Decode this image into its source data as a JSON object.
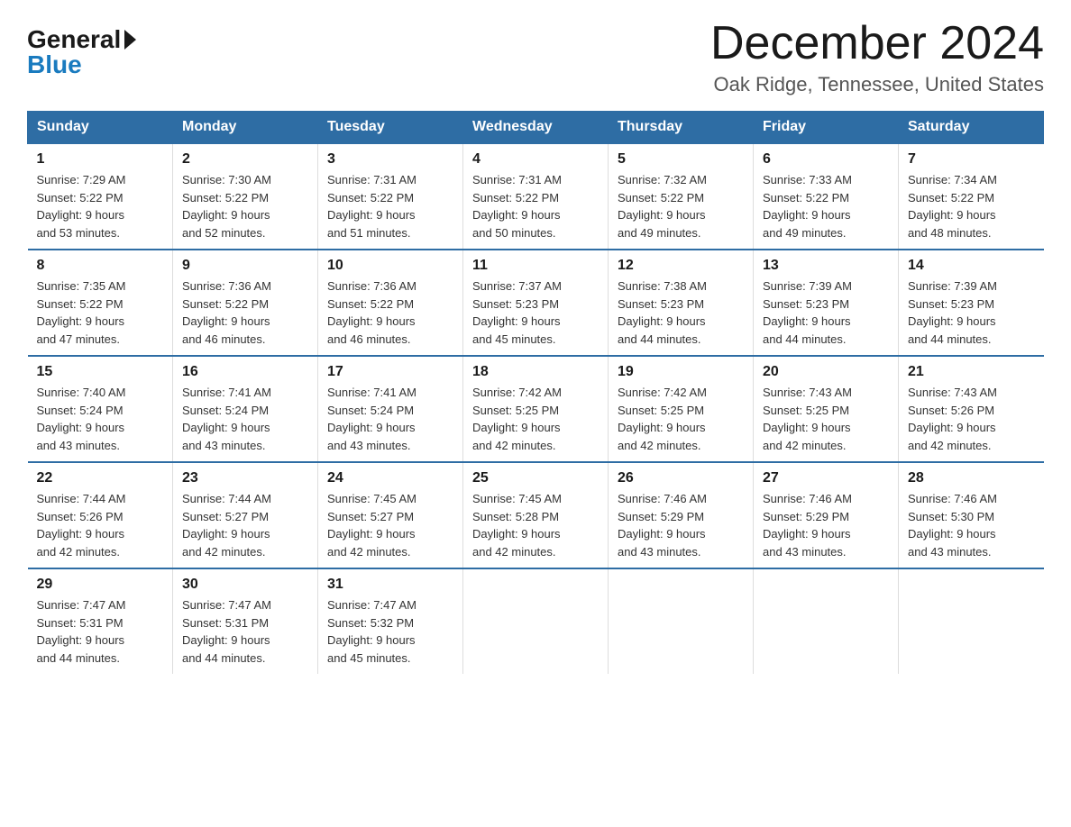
{
  "logo": {
    "general": "General",
    "blue": "Blue"
  },
  "title": {
    "month": "December 2024",
    "location": "Oak Ridge, Tennessee, United States"
  },
  "header": {
    "days": [
      "Sunday",
      "Monday",
      "Tuesday",
      "Wednesday",
      "Thursday",
      "Friday",
      "Saturday"
    ]
  },
  "weeks": [
    [
      {
        "day": "1",
        "sunrise": "7:29 AM",
        "sunset": "5:22 PM",
        "daylight": "9 hours and 53 minutes."
      },
      {
        "day": "2",
        "sunrise": "7:30 AM",
        "sunset": "5:22 PM",
        "daylight": "9 hours and 52 minutes."
      },
      {
        "day": "3",
        "sunrise": "7:31 AM",
        "sunset": "5:22 PM",
        "daylight": "9 hours and 51 minutes."
      },
      {
        "day": "4",
        "sunrise": "7:31 AM",
        "sunset": "5:22 PM",
        "daylight": "9 hours and 50 minutes."
      },
      {
        "day": "5",
        "sunrise": "7:32 AM",
        "sunset": "5:22 PM",
        "daylight": "9 hours and 49 minutes."
      },
      {
        "day": "6",
        "sunrise": "7:33 AM",
        "sunset": "5:22 PM",
        "daylight": "9 hours and 49 minutes."
      },
      {
        "day": "7",
        "sunrise": "7:34 AM",
        "sunset": "5:22 PM",
        "daylight": "9 hours and 48 minutes."
      }
    ],
    [
      {
        "day": "8",
        "sunrise": "7:35 AM",
        "sunset": "5:22 PM",
        "daylight": "9 hours and 47 minutes."
      },
      {
        "day": "9",
        "sunrise": "7:36 AM",
        "sunset": "5:22 PM",
        "daylight": "9 hours and 46 minutes."
      },
      {
        "day": "10",
        "sunrise": "7:36 AM",
        "sunset": "5:22 PM",
        "daylight": "9 hours and 46 minutes."
      },
      {
        "day": "11",
        "sunrise": "7:37 AM",
        "sunset": "5:23 PM",
        "daylight": "9 hours and 45 minutes."
      },
      {
        "day": "12",
        "sunrise": "7:38 AM",
        "sunset": "5:23 PM",
        "daylight": "9 hours and 44 minutes."
      },
      {
        "day": "13",
        "sunrise": "7:39 AM",
        "sunset": "5:23 PM",
        "daylight": "9 hours and 44 minutes."
      },
      {
        "day": "14",
        "sunrise": "7:39 AM",
        "sunset": "5:23 PM",
        "daylight": "9 hours and 44 minutes."
      }
    ],
    [
      {
        "day": "15",
        "sunrise": "7:40 AM",
        "sunset": "5:24 PM",
        "daylight": "9 hours and 43 minutes."
      },
      {
        "day": "16",
        "sunrise": "7:41 AM",
        "sunset": "5:24 PM",
        "daylight": "9 hours and 43 minutes."
      },
      {
        "day": "17",
        "sunrise": "7:41 AM",
        "sunset": "5:24 PM",
        "daylight": "9 hours and 43 minutes."
      },
      {
        "day": "18",
        "sunrise": "7:42 AM",
        "sunset": "5:25 PM",
        "daylight": "9 hours and 42 minutes."
      },
      {
        "day": "19",
        "sunrise": "7:42 AM",
        "sunset": "5:25 PM",
        "daylight": "9 hours and 42 minutes."
      },
      {
        "day": "20",
        "sunrise": "7:43 AM",
        "sunset": "5:25 PM",
        "daylight": "9 hours and 42 minutes."
      },
      {
        "day": "21",
        "sunrise": "7:43 AM",
        "sunset": "5:26 PM",
        "daylight": "9 hours and 42 minutes."
      }
    ],
    [
      {
        "day": "22",
        "sunrise": "7:44 AM",
        "sunset": "5:26 PM",
        "daylight": "9 hours and 42 minutes."
      },
      {
        "day": "23",
        "sunrise": "7:44 AM",
        "sunset": "5:27 PM",
        "daylight": "9 hours and 42 minutes."
      },
      {
        "day": "24",
        "sunrise": "7:45 AM",
        "sunset": "5:27 PM",
        "daylight": "9 hours and 42 minutes."
      },
      {
        "day": "25",
        "sunrise": "7:45 AM",
        "sunset": "5:28 PM",
        "daylight": "9 hours and 42 minutes."
      },
      {
        "day": "26",
        "sunrise": "7:46 AM",
        "sunset": "5:29 PM",
        "daylight": "9 hours and 43 minutes."
      },
      {
        "day": "27",
        "sunrise": "7:46 AM",
        "sunset": "5:29 PM",
        "daylight": "9 hours and 43 minutes."
      },
      {
        "day": "28",
        "sunrise": "7:46 AM",
        "sunset": "5:30 PM",
        "daylight": "9 hours and 43 minutes."
      }
    ],
    [
      {
        "day": "29",
        "sunrise": "7:47 AM",
        "sunset": "5:31 PM",
        "daylight": "9 hours and 44 minutes."
      },
      {
        "day": "30",
        "sunrise": "7:47 AM",
        "sunset": "5:31 PM",
        "daylight": "9 hours and 44 minutes."
      },
      {
        "day": "31",
        "sunrise": "7:47 AM",
        "sunset": "5:32 PM",
        "daylight": "9 hours and 45 minutes."
      },
      null,
      null,
      null,
      null
    ]
  ],
  "labels": {
    "sunrise": "Sunrise: ",
    "sunset": "Sunset: ",
    "daylight": "Daylight: 9 hours"
  }
}
